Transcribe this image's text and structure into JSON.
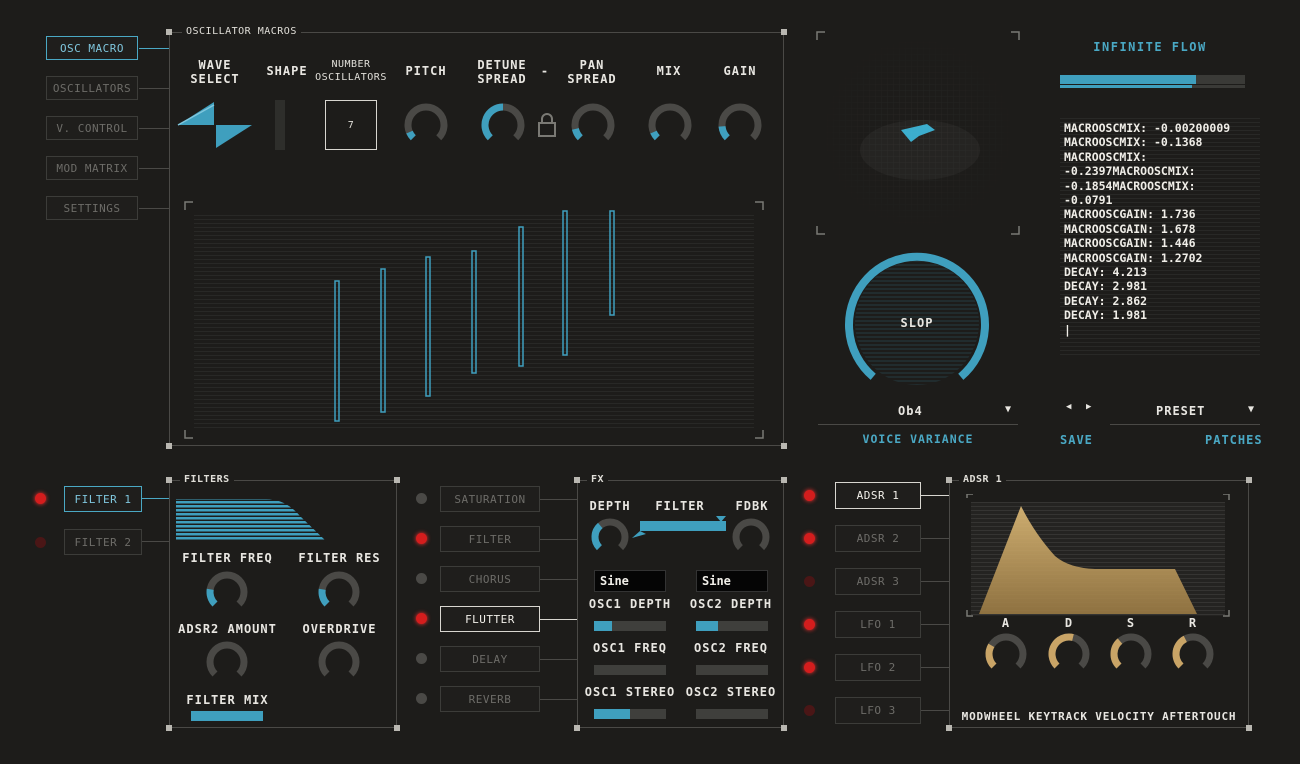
{
  "nav": {
    "items": [
      {
        "label": "OSC MACRO",
        "active": true
      },
      {
        "label": "OSCILLATORS",
        "active": false
      },
      {
        "label": "V. CONTROL",
        "active": false
      },
      {
        "label": "MOD MATRIX",
        "active": false
      },
      {
        "label": "SETTINGS",
        "active": false
      }
    ]
  },
  "osc_macros": {
    "title": "OSCILLATOR MACROS",
    "wave_select": "WAVE\nSELECT",
    "shape": "SHAPE",
    "number_oscillators": "NUMBER\nOSCILLATORS",
    "num_osc_value": "7",
    "pitch": "PITCH",
    "detune_spread": "DETUNE\nSPREAD",
    "dash": "-",
    "pan_spread": "PAN\nSPREAD",
    "mix": "MIX",
    "gain": "GAIN",
    "knob_values": {
      "pitch": 0.08,
      "detune": 0.5,
      "pan": 0.12,
      "mix": 0.08,
      "gain": 0.15
    }
  },
  "right_top": {
    "title": "INFINITE FLOW",
    "slop_label": "SLOP",
    "voice_variance_value": "Ob4",
    "voice_variance_label": "VOICE VARIANCE",
    "preset_label": "PRESET",
    "save_label": "SAVE",
    "patches_label": "PATCHES",
    "prev_arrow": "◀",
    "next_arrow": "▶",
    "dropdown_arrow": "▼",
    "console_lines": [
      "MACROOSCMIX: -0.00200009",
      "MACROOSCMIX: -0.1368",
      "MACROOSCMIX:",
      "-0.2397MACROOSCMIX:",
      "-0.1854MACROOSCMIX:",
      "-0.0791",
      "MACROOSCGAIN: 1.736",
      "MACROOSCGAIN: 1.678",
      "MACROOSCGAIN: 1.446",
      "MACROOSCGAIN: 1.2702",
      "DECAY: 4.213",
      "DECAY: 2.981",
      "DECAY: 2.862",
      "DECAY: 1.981",
      "|"
    ]
  },
  "filters": {
    "title": "FILTERS",
    "filter1": "FILTER 1",
    "filter2": "FILTER 2",
    "filter_freq": "FILTER FREQ",
    "filter_res": "FILTER RES",
    "adsr2_amount": "ADSR2 AMOUNT",
    "overdrive": "OVERDRIVE",
    "filter_mix": "FILTER MIX"
  },
  "fx_list": {
    "items": [
      {
        "label": "SATURATION",
        "active": false,
        "on": false
      },
      {
        "label": "FILTER",
        "active": false,
        "on": true
      },
      {
        "label": "CHORUS",
        "active": false,
        "on": false
      },
      {
        "label": "FLUTTER",
        "active": true,
        "on": true
      },
      {
        "label": "DELAY",
        "active": false,
        "on": false
      },
      {
        "label": "REVERB",
        "active": false,
        "on": false
      }
    ]
  },
  "fx": {
    "title": "FX",
    "depth": "DEPTH",
    "filter": "FILTER",
    "fdbk": "FDBK",
    "osc1_wave": "Sine",
    "osc2_wave": "Sine",
    "osc1_depth": "OSC1 DEPTH",
    "osc2_depth": "OSC2 DEPTH",
    "osc1_freq": "OSC1 FREQ",
    "osc2_freq": "OSC2 FREQ",
    "osc1_stereo": "OSC1 STEREO",
    "osc2_stereo": "OSC2 STEREO",
    "osc1_depth_value": 0.25,
    "osc2_depth_value": 0.3,
    "osc1_freq_value": 0,
    "osc2_freq_value": 0,
    "osc1_stereo_value": 0.5,
    "osc2_stereo_value": 0
  },
  "mod_list": {
    "items": [
      {
        "label": "ADSR 1",
        "active": true,
        "on": true
      },
      {
        "label": "ADSR 2",
        "active": false,
        "on": true
      },
      {
        "label": "ADSR 3",
        "active": false,
        "on": false
      },
      {
        "label": "LFO 1",
        "active": false,
        "on": true
      },
      {
        "label": "LFO 2",
        "active": false,
        "on": true
      },
      {
        "label": "LFO 3",
        "active": false,
        "on": false
      }
    ]
  },
  "adsr": {
    "title": "ADSR 1",
    "a": "A",
    "d": "D",
    "s": "S",
    "r": "R",
    "mod_sources": "MODWHEEL KEYTRACK VELOCITY AFTERTOUCH"
  },
  "colors": {
    "accent": "#4aa8c4",
    "gold": "#c9a466",
    "red": "#d41d1d",
    "bg": "#1d1c1a"
  }
}
